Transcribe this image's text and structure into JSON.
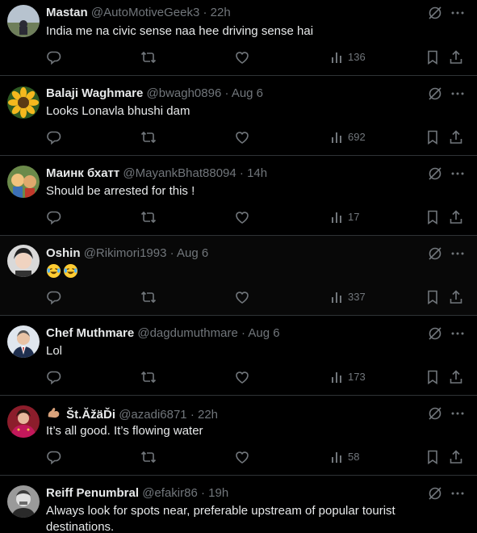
{
  "replies": [
    {
      "name": "Mastan",
      "handle": "@AutoMotiveGeek3",
      "time": "22h",
      "text": "India me na civic sense naa hee driving sense hai",
      "views": "136",
      "avatar": "landscape-photo"
    },
    {
      "name": "Balaji Waghmare",
      "handle": "@bwagh0896",
      "time": "Aug 6",
      "text": "Looks Lonavla bhushi dam",
      "views": "692",
      "avatar": "sunflower-photo"
    },
    {
      "name": "Маинк бхатт",
      "handle": "@MayankBhat88094",
      "time": "14h",
      "text": "Should be arrested for this !",
      "views": "17",
      "avatar": "cartoon-pair-photo"
    },
    {
      "name": "Oshin",
      "handle": "@Rikimori1993",
      "time": "Aug 6",
      "text": "",
      "emoji": [
        "laughing-crying-emoji",
        "laughing-crying-emoji"
      ],
      "views": "337",
      "avatar": "portrait-photo"
    },
    {
      "name": "Chef Muthmare",
      "handle": "@dagdumuthmare",
      "time": "Aug 6",
      "text": "Lol",
      "views": "173",
      "avatar": "suit-portrait-photo"
    },
    {
      "name_prefix_icon": "flexed-biceps-emoji",
      "name": "Št.ĂžäĎi",
      "handle": "@azadi6871",
      "time": "22h",
      "text": "It’s all good. It’s flowing water",
      "views": "58",
      "avatar": "bride-photo"
    },
    {
      "name": "Reiff Penumbral",
      "handle": "@efakir86",
      "time": "19h",
      "text": "Always look for spots near, preferable upstream of popular tourist destinations.",
      "views": "",
      "avatar": "bw-portrait-photo"
    }
  ],
  "separator": "·",
  "icons": {
    "grok": "grok-icon",
    "more": "more-icon",
    "reply": "reply-icon",
    "repost": "repost-icon",
    "like": "like-icon",
    "views": "views-icon",
    "bookmark": "bookmark-icon",
    "share": "share-icon"
  },
  "colors": {
    "background": "#000000",
    "text": "#e7e9ea",
    "muted": "#71767b",
    "divider": "#2f3336"
  }
}
